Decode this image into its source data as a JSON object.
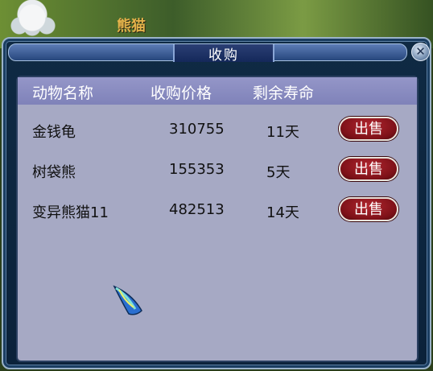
{
  "scene": {
    "pet_name": "熊猫"
  },
  "window": {
    "title": "收购",
    "close_symbol": "✕"
  },
  "table": {
    "headers": [
      "动物名称",
      "收购价格",
      "剩余寿命"
    ],
    "rows": [
      {
        "name": "金钱龟",
        "price": "310755",
        "life": "11天",
        "action": "出售"
      },
      {
        "name": "树袋熊",
        "price": "155353",
        "life": "5天",
        "action": "出售"
      },
      {
        "name": "变异熊猫11",
        "price": "482513",
        "life": "14天",
        "action": "出售"
      }
    ]
  },
  "colors": {
    "sell_button": "#7d1118",
    "content_bg": "#a6a9c4",
    "header_bg": "#8a8cc2"
  },
  "icons": {
    "close": "close-icon",
    "cursor": "feather-cursor-icon"
  }
}
